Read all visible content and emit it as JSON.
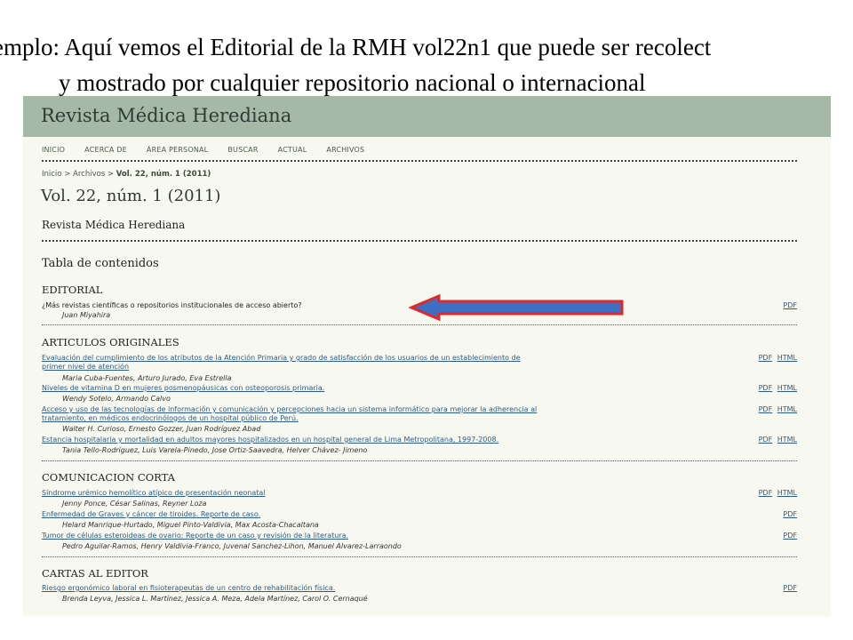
{
  "caption": {
    "line1": "emplo:  Aquí vemos el Editorial de la RMH vol22n1 que puede ser recolect",
    "line2": "y mostrado por cualquier repositorio nacional o internacional"
  },
  "site": {
    "journal_title": "Revista Médica Herediana",
    "nav": [
      "INICIO",
      "ACERCA DE",
      "ÁREA PERSONAL",
      "BUSCAR",
      "ACTUAL",
      "ARCHIVOS"
    ],
    "breadcrumb": {
      "home": "Inicio",
      "sep": ">",
      "archives": "Archivos",
      "current": "Vol. 22, núm. 1 (2011)"
    },
    "issue_title": "Vol. 22, núm. 1 (2011)",
    "issue_subtitle": "Revista Médica Herediana",
    "toc_heading": "Tabla de contenidos",
    "sections": [
      {
        "title": "EDITORIAL",
        "articles": [
          {
            "title": "¿Más revistas científicas o repositorios institucionales de acceso abierto?",
            "authors": "Juan Miyahira",
            "galleys": [
              "PDF"
            ]
          }
        ]
      },
      {
        "title": "ARTICULOS ORIGINALES",
        "articles": [
          {
            "title": "Evaluación del cumplimiento de los atributos de la Atención Primaria y grado de satisfacción de los usuarios de un establecimiento de primer nivel de atención",
            "authors": "Maria Cuba-Fuentes, Arturo Jurado, Eva Estrella",
            "galleys": [
              "PDF",
              "HTML"
            ]
          },
          {
            "title": "Niveles de vitamina D en mujeres posmenopáusicas con osteoporosis primaria.",
            "authors": "Wendy Sotelo, Armando Calvo",
            "galleys": [
              "PDF",
              "HTML"
            ]
          },
          {
            "title": "Acceso y uso de las tecnologías de información y comunicación y percepciones hacia un sistema informático para mejorar la adherencia al tratamiento, en médicos endocrinólogos de un hospital público de Perú.",
            "authors": "Walter H. Curioso, Ernesto Gozzer, Juan Rodríguez Abad",
            "galleys": [
              "PDF",
              "HTML"
            ]
          },
          {
            "title": "Estancia hospitalaria y mortalidad en adultos mayores hospitalizados en un hospital general de Lima Metropolitana, 1997-2008.",
            "authors": "Tania Tello-Rodríguez, Luis Varela-Pinedo, Jose Ortiz-Saavedra, Helver Chávez- Jimeno",
            "galleys": [
              "PDF",
              "HTML"
            ]
          }
        ]
      },
      {
        "title": "COMUNICACION CORTA",
        "articles": [
          {
            "title": "Síndrome urémico hemolítico atípico de presentación neonatal",
            "authors": "Jenny Ponce, César Salinas, Reyner Loza",
            "galleys": [
              "PDF",
              "HTML"
            ]
          },
          {
            "title": "Enfermedad de Graves y cáncer de tiroides. Reporte de caso.",
            "authors": "Helard Manrique-Hurtado, Miguel Pinto-Valdivia, Max Acosta-Chacaltana",
            "galleys": [
              "PDF"
            ]
          },
          {
            "title": "Tumor de células esteroideas de ovario: Reporte de un caso y revisión de la literatura.",
            "authors": "Pedro Aguilar-Ramos, Henry Valdivia-Franco, Juvenal Sanchez-Lihon, Manuel Alvarez-Larraondo",
            "galleys": [
              "PDF"
            ]
          }
        ]
      },
      {
        "title": "CARTAS AL EDITOR",
        "articles": [
          {
            "title": "Riesgo ergonómico laboral en fisioterapeutas de un centro de rehabilitación física.",
            "authors": "Brenda Leyva, Jessica L. Martínez, Jessica A. Meza, Adela Martínez, Carol O. Cernaqué",
            "galleys": [
              "PDF"
            ]
          }
        ]
      }
    ]
  },
  "colors": {
    "banner": "#a6b9a6",
    "page_bg": "#f7f8ef",
    "link": "#2f5a8a",
    "arrow_fill": "#3d6fc4",
    "arrow_stroke": "#e0282a"
  },
  "annotation": {
    "icon": "left-arrow-icon"
  }
}
